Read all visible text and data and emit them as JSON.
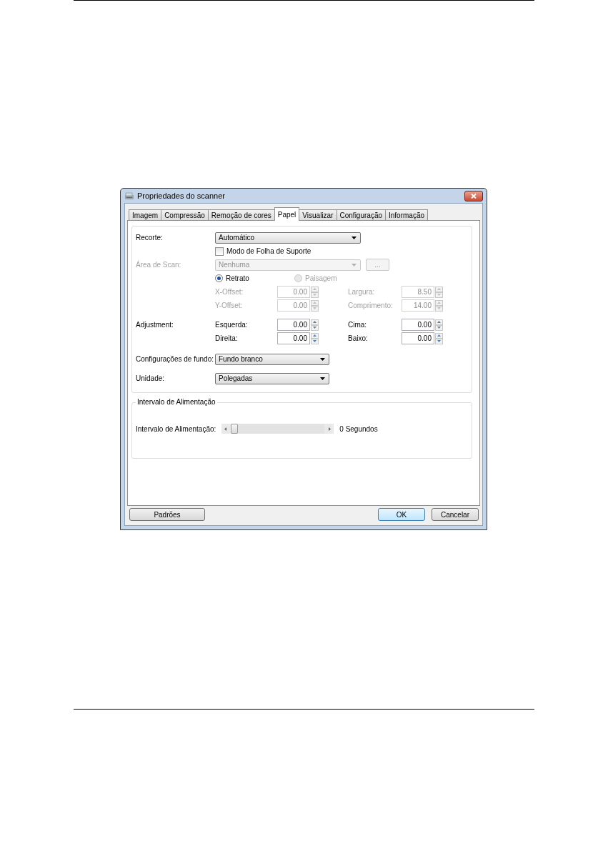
{
  "window": {
    "title": "Propriedades do scanner"
  },
  "tabs": [
    {
      "label": "Imagem",
      "selected": false
    },
    {
      "label": "Compressão",
      "selected": false
    },
    {
      "label": "Remoção de cores",
      "selected": false
    },
    {
      "label": "Papel",
      "selected": true
    },
    {
      "label": "Visualizar",
      "selected": false
    },
    {
      "label": "Configuração",
      "selected": false
    },
    {
      "label": "Informação",
      "selected": false
    }
  ],
  "crop": {
    "label": "Recorte:",
    "value": "Automático",
    "disabled": false
  },
  "support_sheet": {
    "label": "Modo de Folha de Suporte",
    "checked": false
  },
  "scan_area": {
    "label": "Área de Scan:",
    "value": "Nenhuma",
    "disabled": true,
    "button": "..."
  },
  "orientation": [
    {
      "label": "Retrato",
      "selected": true,
      "disabled": false
    },
    {
      "label": "Paisagem",
      "selected": false,
      "disabled": true
    }
  ],
  "position_rows": [
    [
      {
        "label": "X-Offset:",
        "value": "0.00",
        "disabled": true
      },
      {
        "label": "Largura:",
        "value": "8.50",
        "disabled": true
      }
    ],
    [
      {
        "label": "Y-Offset:",
        "value": "0.00",
        "disabled": true
      },
      {
        "label": "Comprimento:",
        "value": "14.00",
        "disabled": true
      }
    ]
  ],
  "adjustment": {
    "label": "Adjustment:",
    "rows": [
      [
        {
          "label": "Esquerda:",
          "value": "0.00",
          "disabled": false
        },
        {
          "label": "Cima:",
          "value": "0.00",
          "disabled": false
        }
      ],
      [
        {
          "label": "Direita:",
          "value": "0.00",
          "disabled": false
        },
        {
          "label": "Baixo:",
          "value": "0.00",
          "disabled": false
        }
      ]
    ]
  },
  "background": {
    "label": "Configurações de fundo:",
    "value": "Fundo branco",
    "disabled": false
  },
  "unit": {
    "label": "Unidade:",
    "value": "Polegadas",
    "disabled": false
  },
  "feed_interval": {
    "title": "Intervalo de Alimentação",
    "label": "Intervalo de Alimentação:",
    "level": 0,
    "reading": "0 Segundos"
  },
  "buttons": [
    {
      "label": "Padrões",
      "default": false
    },
    {
      "label": "OK",
      "default": true
    },
    {
      "label": "Cancelar",
      "default": false
    }
  ]
}
